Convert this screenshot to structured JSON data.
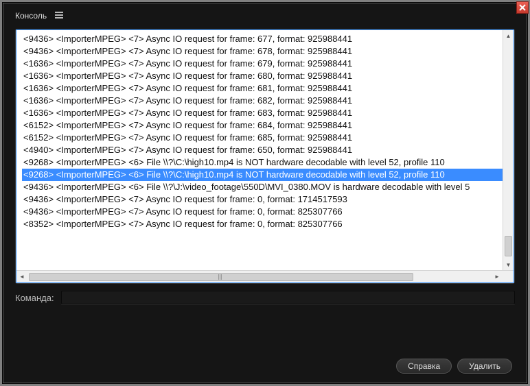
{
  "window": {
    "title": "Консоль",
    "command_label": "Команда:",
    "command_value": "",
    "help_btn": "Справка",
    "delete_btn": "Удалить"
  },
  "icons": {
    "close": "close-icon",
    "menu": "menu-icon"
  },
  "console": {
    "selected_index": 11,
    "lines": [
      "<9436> <ImporterMPEG> <7> Async IO request for frame: 677, format: 925988441",
      "<9436> <ImporterMPEG> <7> Async IO request for frame: 678, format: 925988441",
      "<1636> <ImporterMPEG> <7> Async IO request for frame: 679, format: 925988441",
      "<1636> <ImporterMPEG> <7> Async IO request for frame: 680, format: 925988441",
      "<1636> <ImporterMPEG> <7> Async IO request for frame: 681, format: 925988441",
      "<1636> <ImporterMPEG> <7> Async IO request for frame: 682, format: 925988441",
      "<1636> <ImporterMPEG> <7> Async IO request for frame: 683, format: 925988441",
      "<6152> <ImporterMPEG> <7> Async IO request for frame: 684, format: 925988441",
      "<6152> <ImporterMPEG> <7> Async IO request for frame: 685, format: 925988441",
      "<4940> <ImporterMPEG> <7> Async IO request for frame: 650, format: 925988441",
      "<9268> <ImporterMPEG> <6> File \\\\?\\C:\\high10.mp4 is NOT hardware decodable with level 52, profile 110",
      "<9268> <ImporterMPEG> <6> File \\\\?\\C:\\high10.mp4 is NOT hardware decodable with level 52, profile 110",
      "<9436> <ImporterMPEG> <6> File \\\\?\\J:\\video_footage\\550D\\MVI_0380.MOV is hardware decodable with level 5",
      "<9436> <ImporterMPEG> <7> Async IO request for frame: 0, format: 1714517593",
      "<9436> <ImporterMPEG> <7> Async IO request for frame: 0, format: 825307766",
      "<8352> <ImporterMPEG> <7> Async IO request for frame: 0, format: 825307766"
    ]
  }
}
